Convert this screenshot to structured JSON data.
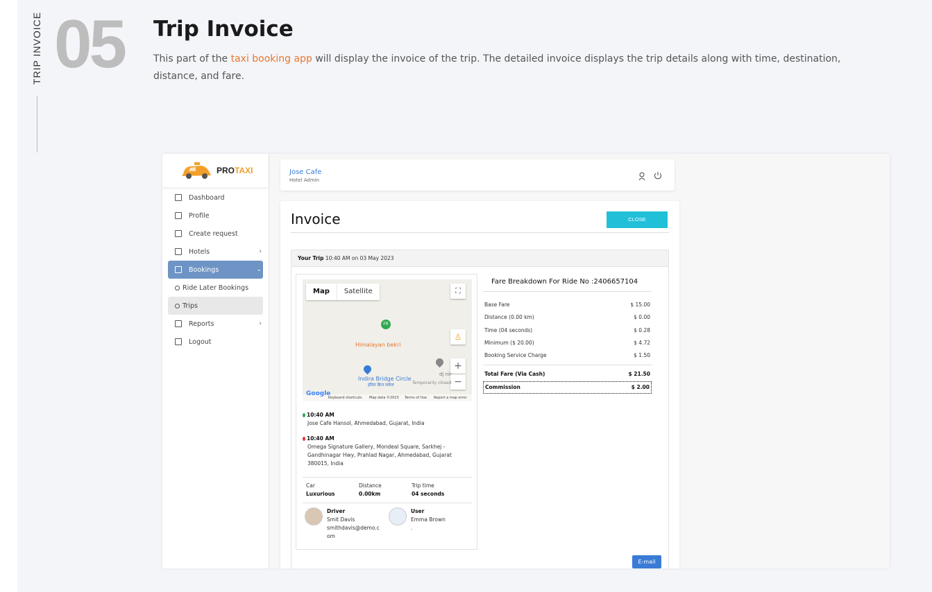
{
  "section": {
    "vertical_label": "TRIP INVOICE",
    "number": "05",
    "title": "Trip Invoice",
    "desc_prefix": "This part of the ",
    "desc_link": "taxi booking app",
    "desc_suffix": " will display the invoice of the trip. The detailed invoice displays the trip details along with time, destination, distance, and fare."
  },
  "app": {
    "logo_pro": "PRO",
    "logo_taxi": "TAXI",
    "nav": [
      {
        "label": "Dashboard",
        "icon": "dashboard-icon"
      },
      {
        "label": "Profile",
        "icon": "profile-icon"
      },
      {
        "label": "Create request",
        "icon": "create-request-icon"
      },
      {
        "label": "Hotels",
        "icon": "hotels-icon"
      },
      {
        "label": "Bookings",
        "icon": "bookings-icon"
      },
      {
        "label": "Ride Later Bookings",
        "icon": "circle-icon"
      },
      {
        "label": "Trips",
        "icon": "circle-icon"
      },
      {
        "label": "Reports",
        "icon": "reports-icon"
      },
      {
        "label": "Logout",
        "icon": "logout-icon"
      }
    ],
    "user_name": "Jose Cafe",
    "user_role": "Hotel Admin"
  },
  "invoice": {
    "title": "Invoice",
    "close_label": "CLOSE",
    "trip_label": "Your Trip",
    "trip_when": "10:40 AM on 03 May 2023",
    "map": {
      "tab_map": "Map",
      "tab_satellite": "Satellite",
      "pin_label": "FR",
      "place1": "Himalayan bekri",
      "place2": "Indira Bridge Circle",
      "place2_local": "इंदिरा ब्रिज सर्कल",
      "place3": "dj nir",
      "temp_closed": "Temporarily closed",
      "google": "Google",
      "footer": [
        "Keyboard shortcuts",
        "Map data ©2023",
        "Terms of Use",
        "Report a map error"
      ]
    },
    "pickup_time": "10:40 AM",
    "pickup_addr": "Jose Cafe Hansol, Ahmedabad, Gujarat, India",
    "drop_time": "10:40 AM",
    "drop_addr_1": "Omega Signature Gallery, Mondeal Square, Sarkhej -",
    "drop_addr_2": "Gandhinagar Hwy, Prahlad Nagar, Ahmedabad, Gujarat",
    "drop_addr_3": "380015, India",
    "stats": [
      {
        "label": "Car",
        "value": "Luxurious"
      },
      {
        "label": "Distance",
        "value": "0.00km"
      },
      {
        "label": "Trip time",
        "value": "04 seconds"
      }
    ],
    "driver": {
      "heading": "Driver",
      "name": "Smit Davis",
      "email_1": "smithdavis@demo.c",
      "email_2": "om"
    },
    "user": {
      "heading": "User",
      "name": "Emma Brown",
      "extra": "."
    },
    "fare_title": "Fare Breakdown For Ride No :2406657104",
    "fare_rows": [
      {
        "label": "Base Fare",
        "value": "$ 15.00"
      },
      {
        "label": "Distance (0.00 km)",
        "value": "$ 0.00"
      },
      {
        "label": "Time (04 seconds)",
        "value": "$ 0.28"
      },
      {
        "label": "Minimum ($ 20.00)",
        "value": "$ 4.72"
      },
      {
        "label": "Booking Service Charge",
        "value": "$ 1.50"
      }
    ],
    "total_label": "Total Fare (Via Cash)",
    "total_value": "$ 21.50",
    "commission_label": "Commission",
    "commission_value": "$ 2.00",
    "email_label": "E-mail"
  },
  "colors": {
    "accent_orange": "#e8772e",
    "cyan": "#21c0d8",
    "blue": "#3a7bd5",
    "nav_active": "#6e94c5"
  }
}
